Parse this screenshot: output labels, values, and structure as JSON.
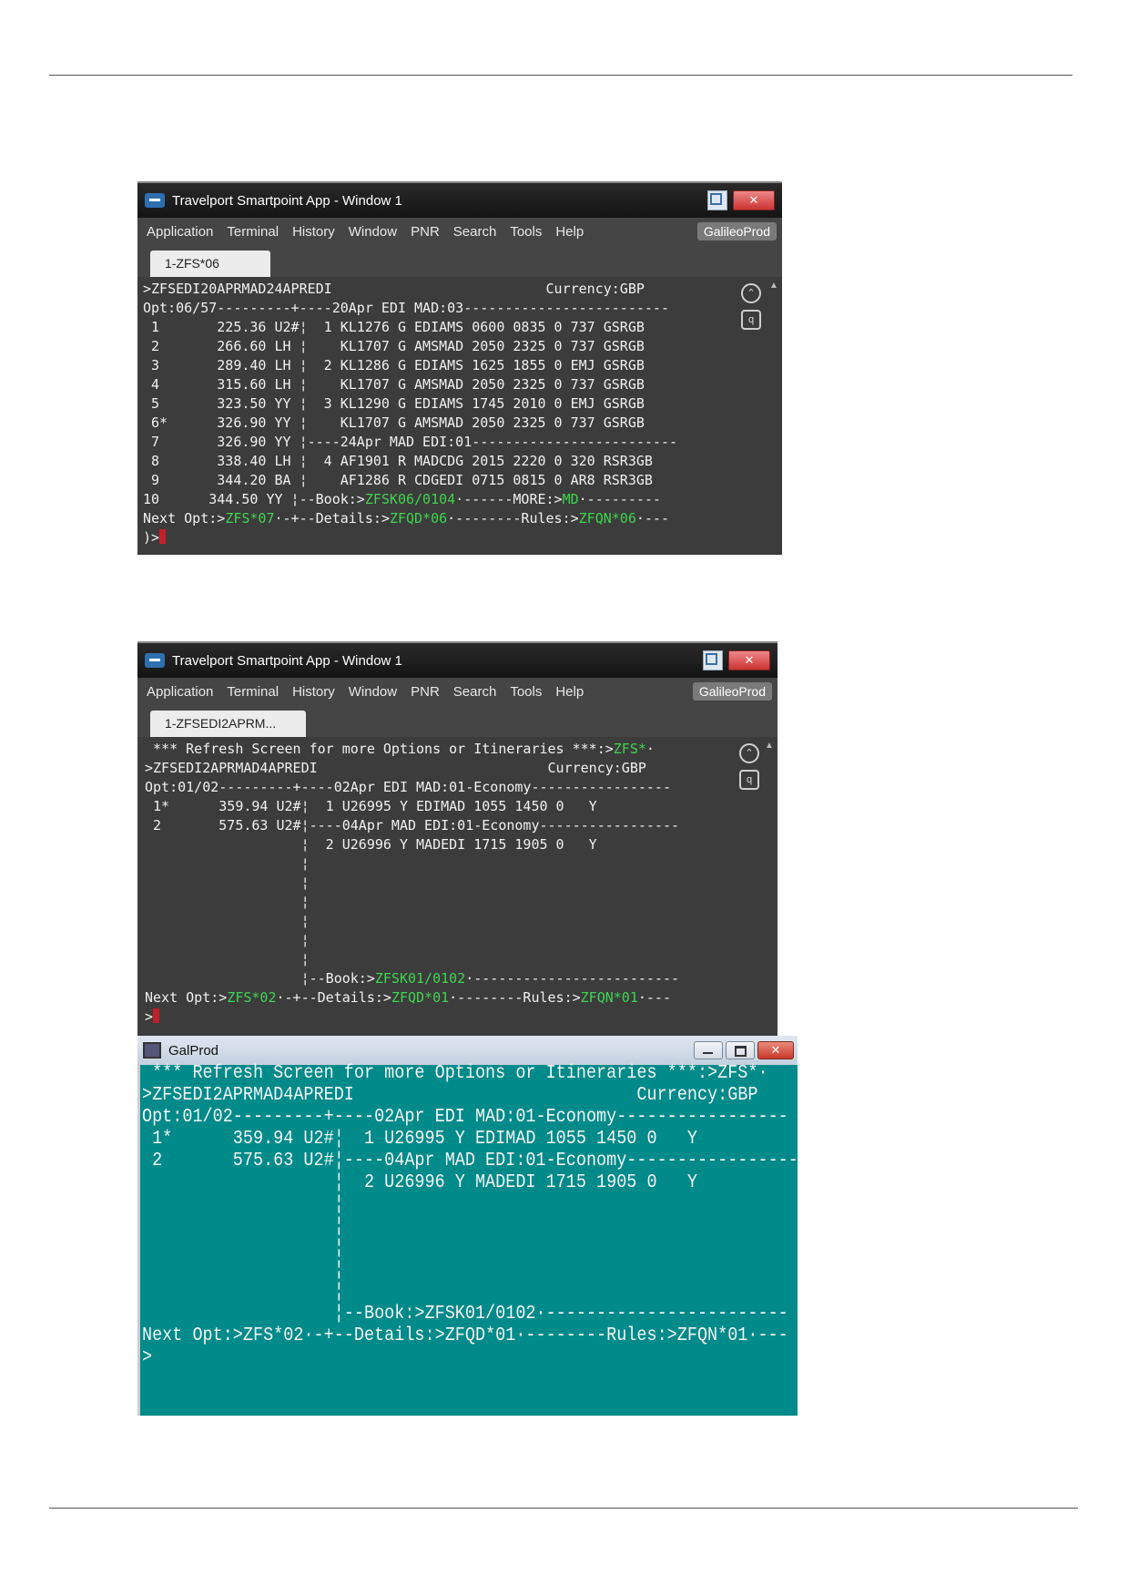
{
  "window1": {
    "title": "Travelport Smartpoint App - Window 1",
    "close_label": "✕",
    "menu": [
      "Application",
      "Terminal",
      "History",
      "Window",
      "PNR",
      "Search",
      "Tools",
      "Help"
    ],
    "env_badge": "GalileoProd",
    "tab_label": "1-ZFS*06",
    "scroll_up": "▲",
    "lines": [
      ">ZFSEDI20APRMAD24APREDI                          Currency:GBP",
      "Opt:06/57---------+----20Apr EDI MAD:03-------------------------",
      " 1       225.36 U2#¦  1 KL1276 G EDIAMS 0600 0835 0 737 GSRGB",
      " 2       266.60 LH ¦    KL1707 G AMSMAD 2050 2325 0 737 GSRGB",
      " 3       289.40 LH ¦  2 KL1286 G EDIAMS 1625 1855 0 EMJ GSRGB",
      " 4       315.60 LH ¦    KL1707 G AMSMAD 2050 2325 0 737 GSRGB",
      " 5       323.50 YY ¦  3 KL1290 G EDIAMS 1745 2010 0 EMJ GSRGB",
      " 6*      326.90 YY ¦    KL1707 G AMSMAD 2050 2325 0 737 GSRGB",
      " 7       326.90 YY ¦----24Apr MAD EDI:01-------------------------",
      " 8       338.40 LH ¦  4 AF1901 R MADCDG 2015 2220 0 320 RSR3GB",
      " 9       344.20 BA ¦    AF1286 R CDGEDI 0715 0815 0 AR8 RSR3GB"
    ],
    "line10": {
      "prefix": "10      344.50 YY ¦--Book:>",
      "book": "ZFSK06/0104",
      "mid": "·------MORE:>",
      "more": "MD",
      "suffix": "·---------"
    },
    "next": {
      "prefix": "Next Opt:>",
      "opt": "ZFS*07",
      "mid1": "·-+--Details:>",
      "details": "ZFQD*06",
      "mid2": "·--------Rules:>",
      "rules": "ZFQN*06",
      "suffix": "·---"
    },
    "prompt": ")>"
  },
  "window2": {
    "title": "Travelport Smartpoint App - Window 1",
    "close_label": "✕",
    "menu": [
      "Application",
      "Terminal",
      "History",
      "Window",
      "PNR",
      "Search",
      "Tools",
      "Help"
    ],
    "env_badge": "GalileoProd",
    "tab_label": "1-ZFSEDI2APRM...",
    "scroll_up": "▲",
    "refresh": {
      "prefix": " *** Refresh Screen for more Options or Itineraries ***:>",
      "cmd": "ZFS*",
      "suffix": "·"
    },
    "lines": [
      ">ZFSEDI2APRMAD4APREDI                            Currency:GBP",
      "Opt:01/02---------+----02Apr EDI MAD:01-Economy-----------------",
      " 1*      359.94 U2#¦  1 U26995 Y EDIMAD 1055 1450 0   Y",
      " 2       575.63 U2#¦----04Apr MAD EDI:01-Economy-----------------",
      "                   ¦  2 U26996 Y MADEDI 1715 1905 0   Y",
      "                   ¦",
      "                   ¦",
      "                   ¦",
      "                   ¦",
      "                   ¦",
      "                   ¦"
    ],
    "book": {
      "prefix": "                   ¦--Book:>",
      "cmd": "ZFSK01/0102",
      "suffix": "·-------------------------"
    },
    "next": {
      "prefix": "Next Opt:>",
      "opt": "ZFS*02",
      "mid1": "·-+--Details:>",
      "details": "ZFQD*01",
      "mid2": "·--------Rules:>",
      "rules": "ZFQN*01",
      "suffix": "·---"
    },
    "prompt": ">"
  },
  "window3": {
    "title": "GalProd",
    "close_label": "✕",
    "lines": [
      " *** Refresh Screen for more Options or Itineraries ***:>ZFS*·",
      ">ZFSEDI2APRMAD4APREDI                            Currency:GBP",
      "Opt:01/02---------+----02Apr EDI MAD:01-Economy-----------------",
      " 1*      359.94 U2#¦  1 U26995 Y EDIMAD 1055 1450 0   Y",
      " 2       575.63 U2#¦----04Apr MAD EDI:01-Economy-----------------",
      "                   ¦  2 U26996 Y MADEDI 1715 1905 0   Y",
      "                   ¦",
      "                   ¦",
      "                   ¦",
      "                   ¦",
      "                   ¦",
      "                   ¦--Book:>ZFSK01/0102·------------------------",
      "Next Opt:>ZFS*02·-+--Details:>ZFQD*01·--------Rules:>ZFQN*01·---",
      ">"
    ]
  },
  "colors": {
    "terminal_bg": "#3c3c3c",
    "command_green": "#3fd44f",
    "legacy_bg": "#018a8a",
    "cursor": "#c0202a"
  }
}
